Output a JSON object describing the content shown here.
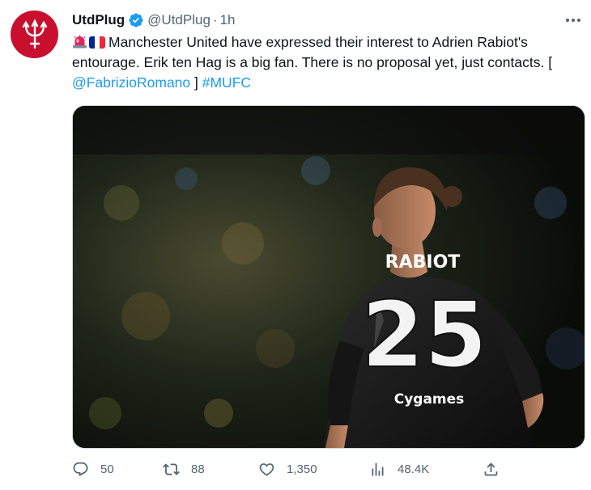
{
  "author": {
    "name": "UtdPlug",
    "handle": "@UtdPlug",
    "separator": "·",
    "time": "1h"
  },
  "tweet": {
    "emojis": [
      "police-siren-emoji",
      "france-flag-emoji"
    ],
    "text_main": "Manchester United have expressed their interest to Adrien Rabiot's entourage. Erik ten Hag is a big fan. There is no proposal yet, just contacts. [ ",
    "mention": "@FabrizioRomano",
    "text_after_mention": " ] ",
    "hashtag": "#MUFC"
  },
  "media": {
    "shirt_name": "RABIOT",
    "shirt_number": "25",
    "sponsor": "Cygames"
  },
  "actions": {
    "reply_count": "50",
    "retweet_count": "88",
    "like_count": "1,350",
    "views_count": "48.4K"
  },
  "colors": {
    "accent": "#1d9bf0",
    "avatar_bg": "#c8102e",
    "muted": "#536471"
  }
}
